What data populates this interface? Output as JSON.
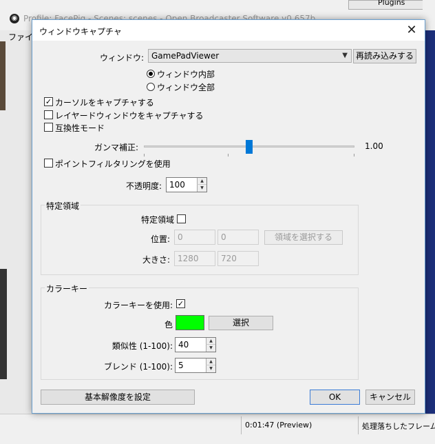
{
  "background": {
    "title": "Profile: FacePig - Scenes: scenes - Open Broadcaster Software v0.657b",
    "menu_file": "ファイル",
    "plugins_label": "Plugins",
    "status_time": "0:01:47 (Preview)",
    "status_dropped": "処理落ちしたフレーム:"
  },
  "dialog": {
    "title": "ウィンドウキャプチャ",
    "close_symbol": "✕",
    "window_label": "ウィンドウ:",
    "window_value": "GamePadViewer",
    "reload_button": "再読み込みする",
    "radio_inner": "ウィンドウ内部",
    "radio_full": "ウィンドウ全部",
    "capture_cursor": "カーソルをキャプチャする",
    "capture_layered": "レイヤードウィンドウをキャプチャする",
    "compat_mode": "互換性モード",
    "gamma_label": "ガンマ補正:",
    "gamma_value": "1.00",
    "gamma_level": 0.5,
    "point_filter": "ポイントフィルタリングを使用",
    "opacity_label": "不透明度:",
    "opacity_value": "100",
    "region": {
      "group_label": "特定領域",
      "enable_label": "特定領域",
      "position_label": "位置:",
      "position_x": "0",
      "position_y": "0",
      "select_button": "領域を選択する",
      "size_label": "大きさ:",
      "size_w": "1280",
      "size_h": "720"
    },
    "colorkey": {
      "group_label": "カラーキー",
      "use_label": "カラーキーを使用:",
      "check_mark": "✓",
      "color_label": "色",
      "color_hex": "#00ff00",
      "select_button": "選択",
      "similarity_label": "類似性 (1-100):",
      "similarity_value": "40",
      "blend_label": "ブレンド (1-100):",
      "blend_value": "5"
    },
    "base_resolution_button": "基本解像度を設定",
    "ok_button": "OK",
    "cancel_button": "キャンセル",
    "check_mark": "✓"
  }
}
